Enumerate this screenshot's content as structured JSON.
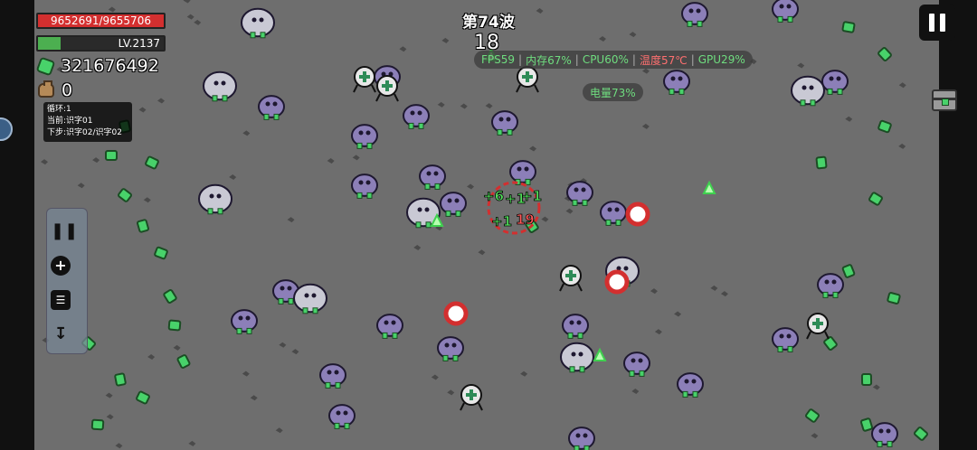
{
  "player": {
    "hp_text": "9652691/9655706",
    "hp_fraction": 0.9997,
    "level_text": "LV.2137",
    "exp_fraction": 0.18,
    "gems": "321676492",
    "bags": "0"
  },
  "info_box": {
    "line1": "循环:1",
    "line2": "当前:识字01",
    "line3": "下步:识字02/识字02"
  },
  "wave": {
    "title": "第74波",
    "timer": "18"
  },
  "perf": {
    "fps": "FPS59",
    "memory": "内存67%",
    "cpu": "CPU60%",
    "temp": "温度57℃",
    "gpu": "GPU29%",
    "battery": "电量73%"
  },
  "colors": {
    "ground": "#6e6e6e",
    "hp": "#d32f2f",
    "exp": "#4caf50",
    "gem": "#48d26a",
    "enemy": "#8c7fb8",
    "healthy_text": "#6fdd7f",
    "hot_text": "#ff7070"
  },
  "damage_popups": [
    "+6",
    "+1",
    "+1",
    "+1",
    "19"
  ],
  "toolbar": {
    "icons": [
      "pause-list-icon",
      "add-icon",
      "document-icon",
      "collapse-icon"
    ]
  }
}
